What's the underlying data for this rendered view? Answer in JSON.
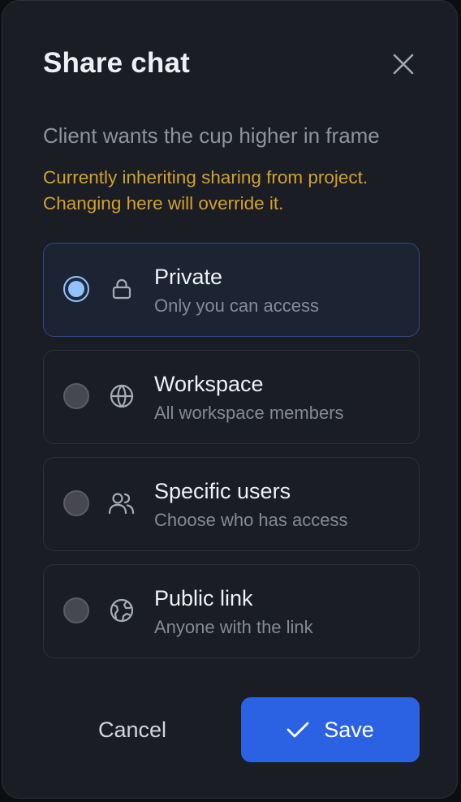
{
  "dialog": {
    "title": "Share chat",
    "subtitle": "Client wants the cup higher in frame",
    "warning": "Currently inheriting sharing from project. Changing here will override it."
  },
  "options": [
    {
      "title": "Private",
      "description": "Only you can access",
      "icon": "lock-icon",
      "selected": true
    },
    {
      "title": "Workspace",
      "description": "All workspace members",
      "icon": "globe-icon",
      "selected": false
    },
    {
      "title": "Specific users",
      "description": "Choose who has access",
      "icon": "users-icon",
      "selected": false
    },
    {
      "title": "Public link",
      "description": "Anyone with the link",
      "icon": "world-icon",
      "selected": false
    }
  ],
  "actions": {
    "cancel_label": "Cancel",
    "save_label": "Save"
  },
  "colors": {
    "background": "#1a1d24",
    "accent": "#2b62e3",
    "warning": "#d4a12d",
    "selected_radio": "#93c1fb"
  }
}
